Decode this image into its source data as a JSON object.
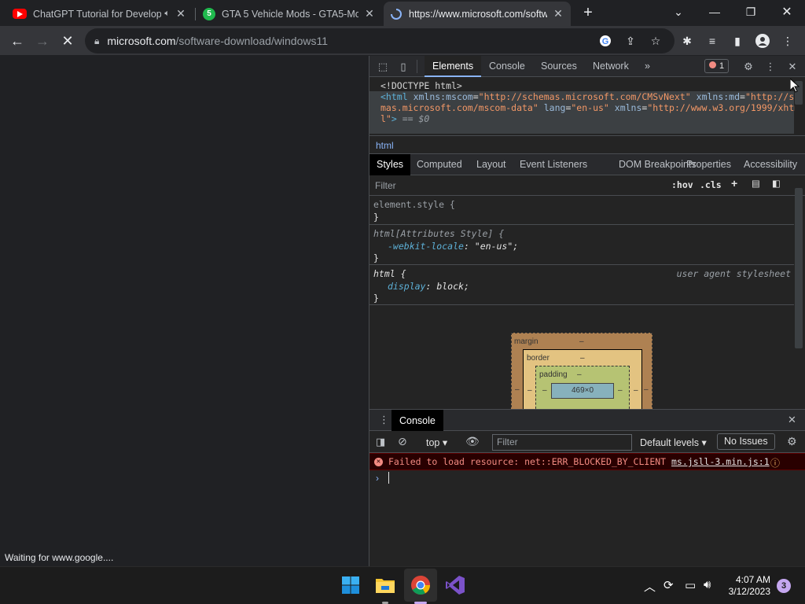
{
  "tabs": [
    {
      "title": "ChatGPT Tutorial for Develop",
      "favicon_color": "#ff0000",
      "favicon": "youtube-icon",
      "muted_icon": "speaker-icon",
      "active": false
    },
    {
      "title": "GTA 5 Vehicle Mods - GTA5-Mod",
      "favicon_color": "#20ba4e",
      "favicon": "gta5mods-icon",
      "active": false
    },
    {
      "title": "https://www.microsoft.com/softw",
      "favicon": "loading-spinner-icon",
      "active": true
    }
  ],
  "address_bar": {
    "host": "microsoft.com",
    "path": "/software-download/windows11"
  },
  "status_text": "Waiting for www.google....",
  "devtools": {
    "main_tabs": [
      "Elements",
      "Console",
      "Sources",
      "Network"
    ],
    "more_tabs": "»",
    "error_count": "1",
    "dom": {
      "doctype": "<!DOCTYPE html>",
      "html_open": "<html",
      "attr1_name": "xmlns:mscom",
      "attr1_val": "\"http://schemas.microsoft.com/CMSvNext\"",
      "attr2_name": "xmlns:md",
      "attr2_val_a": "\"http://sche",
      "attr2_val_b": "mas.microsoft.com/mscom-data\"",
      "attr3_name": "lang",
      "attr3_val": "\"en-us\"",
      "attr4_name": "xmlns",
      "attr4_val_a": "\"http://www.w3.org/1999/xhtm",
      "attr4_val_b": "l\"",
      "close": ">",
      "eq0": " == $0"
    },
    "breadcrumb": "html",
    "style_tabs": [
      "Styles",
      "Computed",
      "Layout",
      "Event Listeners",
      "DOM Breakpoints",
      "Properties",
      "Accessibility"
    ],
    "filter_placeholder": "Filter",
    "hov": ":hov",
    "cls": ".cls",
    "rules": {
      "r1_selector": "element.style {",
      "r1_close": "}",
      "r2_selector": "html[Attributes Style] {",
      "r2_prop": "-webkit-locale",
      "r2_val": "\"en-us\";",
      "r2_close": "}",
      "r3_selector": "html {",
      "r3_source": "user agent stylesheet",
      "r3_prop": "display",
      "r3_val": "block;",
      "r3_close": "}"
    },
    "box_model": {
      "margin": "margin",
      "border": "border",
      "padding": "padding",
      "content": "469×0",
      "dash": "–"
    },
    "drawer": {
      "tab": "Console",
      "context": "top",
      "filter_placeholder": "Filter",
      "levels": "Default levels",
      "issues": "No Issues",
      "error_message": "Failed to load resource: net::ERR_BLOCKED_BY_CLIENT",
      "error_source": "ms.jsll-3.min.js:1",
      "prompt": "›"
    }
  },
  "taskbar": {
    "time": "4:07 AM",
    "date": "3/12/2023",
    "notifications": "3"
  }
}
